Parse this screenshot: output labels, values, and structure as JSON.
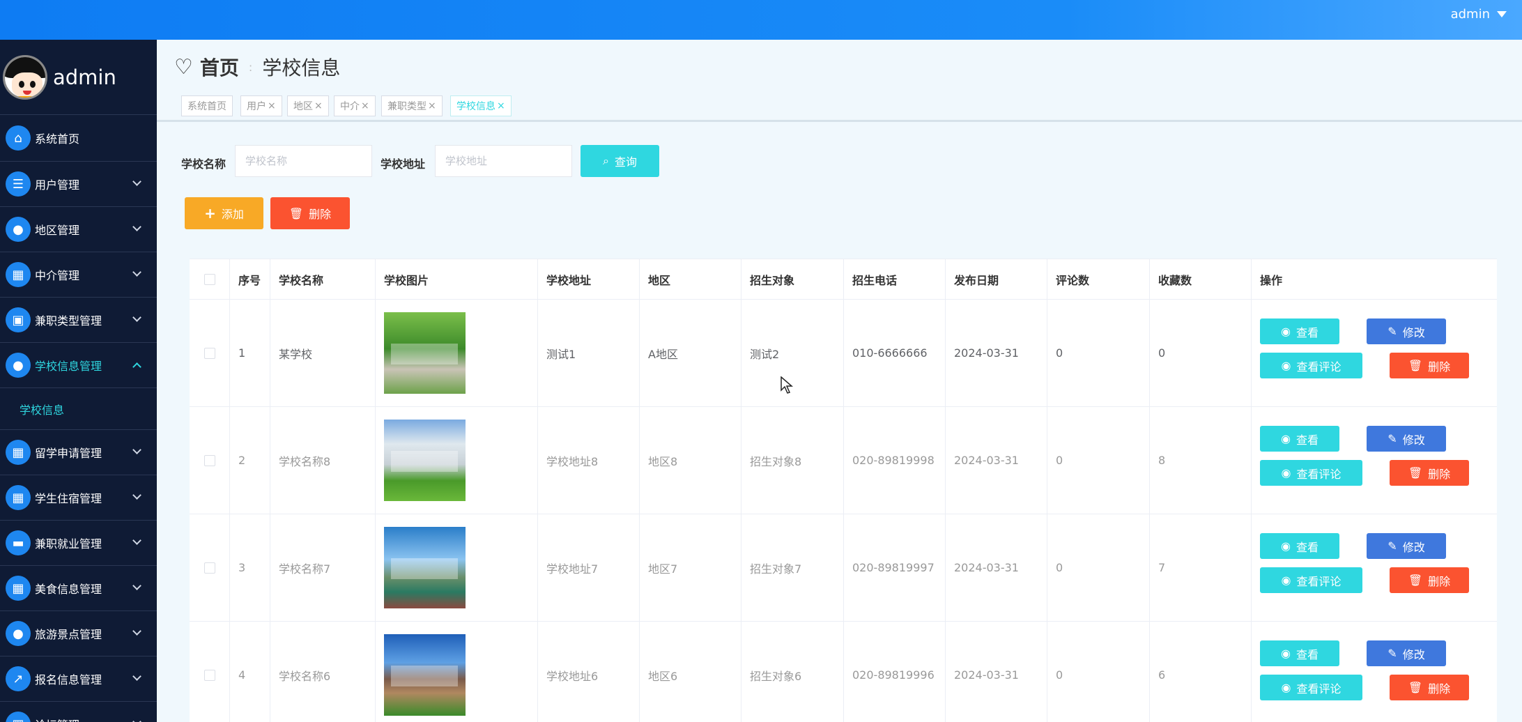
{
  "topbar": {
    "user": "admin"
  },
  "sidebar": {
    "profile_name": "admin",
    "items": [
      {
        "label": "系统首页",
        "icon": "home-icon",
        "glyph": "⌂"
      },
      {
        "label": "用户管理",
        "icon": "list-icon",
        "glyph": "☰"
      },
      {
        "label": "地区管理",
        "icon": "user-icon",
        "glyph": "●"
      },
      {
        "label": "中介管理",
        "icon": "grid-icon",
        "glyph": "▦"
      },
      {
        "label": "兼职类型管理",
        "icon": "wallet-icon",
        "glyph": "▣"
      },
      {
        "label": "学校信息管理",
        "icon": "person-icon",
        "glyph": "●"
      },
      {
        "label": "留学申请管理",
        "icon": "grid-icon",
        "glyph": "▦"
      },
      {
        "label": "学生住宿管理",
        "icon": "grid-icon",
        "glyph": "▦"
      },
      {
        "label": "兼职就业管理",
        "icon": "briefcase-icon",
        "glyph": "▬"
      },
      {
        "label": "美食信息管理",
        "icon": "grid-icon",
        "glyph": "▦"
      },
      {
        "label": "旅游景点管理",
        "icon": "bulb-icon",
        "glyph": "●"
      },
      {
        "label": "报名信息管理",
        "icon": "chart-icon",
        "glyph": "↗"
      },
      {
        "label": "论坛管理",
        "icon": "grid-icon",
        "glyph": "▦"
      }
    ],
    "sub_item": "学校信息"
  },
  "breadcrumb": {
    "home": "首页",
    "separator": ":",
    "current": "学校信息"
  },
  "tags": [
    {
      "label": "系统首页",
      "closable": false
    },
    {
      "label": "用户",
      "closable": true
    },
    {
      "label": "地区",
      "closable": true
    },
    {
      "label": "中介",
      "closable": true
    },
    {
      "label": "兼职类型",
      "closable": true
    },
    {
      "label": "学校信息",
      "closable": true
    }
  ],
  "search": {
    "name_label": "学校名称",
    "name_placeholder": "学校名称",
    "address_label": "学校地址",
    "address_placeholder": "学校地址",
    "query_label": "查询"
  },
  "actions": {
    "add_label": "添加",
    "delete_label": "删除"
  },
  "table": {
    "headers": [
      "序号",
      "学校名称",
      "学校图片",
      "学校地址",
      "地区",
      "招生对象",
      "招生电话",
      "发布日期",
      "评论数",
      "收藏数",
      "操作"
    ],
    "rows": [
      {
        "index": "1",
        "name": "某学校",
        "address": "测试1",
        "region": "A地区",
        "target": "测试2",
        "phone": "010-6666666",
        "date": "2024-03-31",
        "comments": "0",
        "favorites": "0"
      },
      {
        "index": "2",
        "name": "学校名称8",
        "address": "学校地址8",
        "region": "地区8",
        "target": "招生对象8",
        "phone": "020-89819998",
        "date": "2024-03-31",
        "comments": "0",
        "favorites": "8"
      },
      {
        "index": "3",
        "name": "学校名称7",
        "address": "学校地址7",
        "region": "地区7",
        "target": "招生对象7",
        "phone": "020-89819997",
        "date": "2024-03-31",
        "comments": "0",
        "favorites": "7"
      },
      {
        "index": "4",
        "name": "学校名称6",
        "address": "学校地址6",
        "region": "地区6",
        "target": "招生对象6",
        "phone": "020-89819996",
        "date": "2024-03-31",
        "comments": "0",
        "favorites": "6"
      }
    ],
    "ops": {
      "view": "查看",
      "edit": "修改",
      "comments": "查看评论",
      "delete": "删除"
    }
  },
  "colors": {
    "accent": "#2fd7e0",
    "topbar": "#0e7cf3",
    "sidebar": "#0f1b35",
    "warning": "#f8a926",
    "danger": "#fb5330",
    "primary": "#3f78dd"
  }
}
